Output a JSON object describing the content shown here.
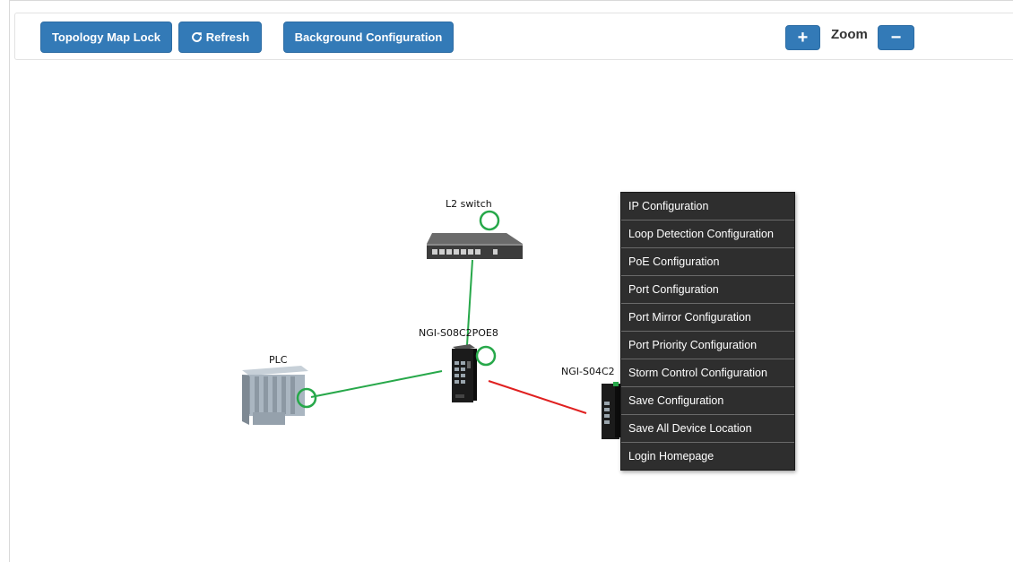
{
  "toolbar": {
    "lock_label": "Topology Map Lock",
    "refresh_label": "Refresh",
    "background_label": "Background Configuration",
    "zoom_label": "Zoom",
    "zoom_in_symbol": "+",
    "zoom_out_symbol": "−"
  },
  "topology": {
    "nodes": [
      {
        "name": "L2 switch",
        "icon": "network-switch-icon",
        "status": "green"
      },
      {
        "name": "NGI-S08C2POE8",
        "icon": "industrial-switch-icon",
        "status": "green"
      },
      {
        "name": "PLC",
        "icon": "plc-icon",
        "status": "green"
      },
      {
        "name": "NGI-S04C2",
        "icon": "industrial-switch-icon",
        "status": "green"
      }
    ],
    "links": [
      {
        "from": "L2 switch",
        "to": "NGI-S08C2POE8",
        "color": "#27a84a"
      },
      {
        "from": "PLC",
        "to": "NGI-S08C2POE8",
        "color": "#27a84a"
      },
      {
        "from": "NGI-S08C2POE8",
        "to": "NGI-S04C2",
        "color": "#e02020"
      }
    ]
  },
  "context_menu": {
    "items": [
      "IP Configuration",
      "Loop Detection Configuration",
      "PoE Configuration",
      "Port Configuration",
      "Port Mirror Configuration",
      "Port Priority Configuration",
      "Storm Control Configuration",
      "Save Configuration",
      "Save All Device Location",
      "Login Homepage"
    ]
  },
  "colors": {
    "primary": "#337ab7",
    "link_up": "#27a84a",
    "link_down": "#e02020",
    "menu_bg": "#2e2e2e"
  }
}
